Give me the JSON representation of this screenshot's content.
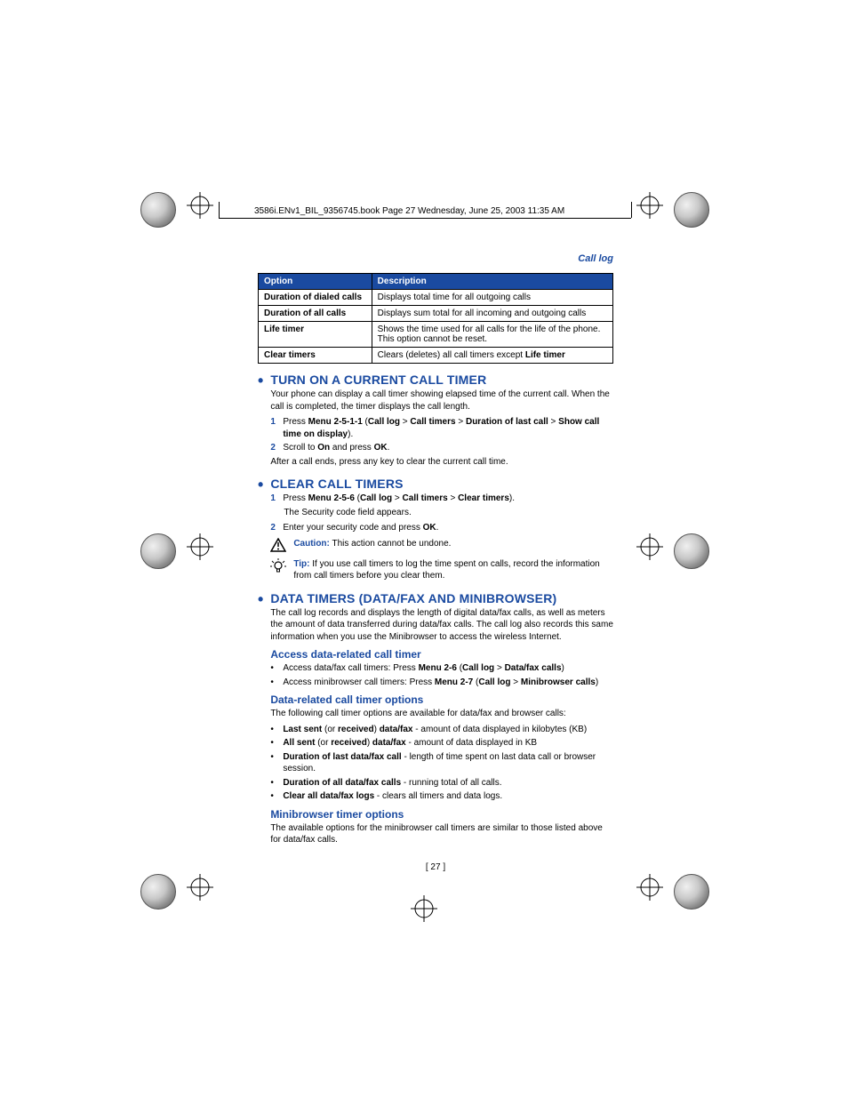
{
  "header_line": "3586i.ENv1_BIL_9356745.book  Page 27  Wednesday, June 25, 2003  11:35 AM",
  "breadcrumb": "Call log",
  "table": {
    "headers": [
      "Option",
      "Description"
    ],
    "rows": [
      [
        "Duration of dialed calls",
        "Displays total time for all outgoing calls"
      ],
      [
        "Duration of all calls",
        "Displays sum total for all incoming and outgoing calls"
      ],
      [
        "Life timer",
        "Shows the time used for all calls for the life of the phone. This option cannot be reset."
      ]
    ],
    "last_row_label": "Clear timers",
    "last_row_prefix": "Clears (deletes) all call timers except ",
    "last_row_bold": "Life timer"
  },
  "s1": {
    "title": "TURN ON A CURRENT CALL TIMER",
    "intro": "Your phone can display a call timer showing elapsed time of the current call. When the call is completed, the timer displays the call length.",
    "step1_a": "Press ",
    "step1_b": "Menu 2-5-1-1",
    "step1_c": " (",
    "step1_d": "Call log",
    "step1_e": " > ",
    "step1_f": "Call timers",
    "step1_g": " > ",
    "step1_h": "Duration of last call",
    "step1_i": " > ",
    "step1_j": "Show call time on display",
    "step1_k": ").",
    "step2_a": "Scroll to ",
    "step2_b": "On",
    "step2_c": " and press ",
    "step2_d": "OK",
    "step2_e": ".",
    "after": "After a call ends, press any key to clear the current call time."
  },
  "s2": {
    "title": "CLEAR CALL TIMERS",
    "step1_a": "Press ",
    "step1_b": "Menu 2-5-6",
    "step1_c": " (",
    "step1_d": "Call log",
    "step1_e": " > ",
    "step1_f": "Call timers",
    "step1_g": " > ",
    "step1_h": "Clear timers",
    "step1_i": ").",
    "step1_followup": "The Security code field appears.",
    "step2_a": "Enter your security code and press ",
    "step2_b": "OK",
    "step2_c": ".",
    "caution_label": "Caution:",
    "caution_text": " This action cannot be undone.",
    "tip_label": "Tip:",
    "tip_text": " If you use call timers to log the time spent on calls, record the information from call timers before you clear them."
  },
  "s3": {
    "title": "DATA TIMERS (DATA/FAX AND MINIBROWSER)",
    "intro": "The call log records and displays the length of digital data/fax calls, as well as meters the amount of data transferred during data/fax calls. The call log also records this same information when you use the Minibrowser to access the wireless Internet.",
    "sub1": "Access data-related call timer",
    "b1_a": "Access data/fax call timers: Press ",
    "b1_b": "Menu 2-6",
    "b1_c": " (",
    "b1_d": "Call log",
    "b1_e": " > ",
    "b1_f": "Data/fax calls",
    "b1_g": ")",
    "b2_a": "Access minibrowser call timers: Press ",
    "b2_b": "Menu 2-7",
    "b2_c": " (",
    "b2_d": "Call log",
    "b2_e": " > ",
    "b2_f": "Minibrowser calls",
    "b2_g": ")",
    "sub2": "Data-related call timer options",
    "sub2_intro": "The following call timer options are available for data/fax and browser calls:",
    "opt1_b": "Last sent",
    "opt1_m": " (or ",
    "opt1_b2": "received",
    "opt1_m2": ") ",
    "opt1_b3": "data/fax",
    "opt1_r": " - amount of data displayed in kilobytes (KB)",
    "opt2_b": "All sent",
    "opt2_m": " (or ",
    "opt2_b2": "received",
    "opt2_m2": ") ",
    "opt2_b3": "data/fax",
    "opt2_r": " - amount of data displayed in KB",
    "opt3_b": "Duration of last data/fax call",
    "opt3_r": " - length of time spent on last data call or browser session.",
    "opt4_b": "Duration of all data/fax calls",
    "opt4_r": " - running total of all calls.",
    "opt5_b": "Clear all data/fax logs",
    "opt5_r": " - clears all timers and data logs.",
    "sub3": "Minibrowser timer options",
    "sub3_text": "The available options for the minibrowser call timers are similar to those listed above for data/fax calls."
  },
  "page_num": "[ 27 ]"
}
